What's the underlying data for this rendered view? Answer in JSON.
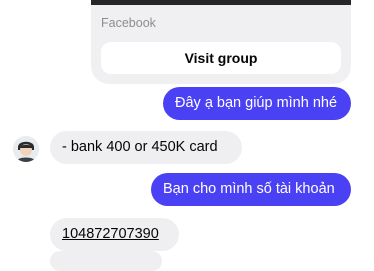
{
  "shared_card": {
    "source": "Facebook",
    "button_label": "Visit group"
  },
  "messages": [
    {
      "direction": "outgoing",
      "text": "Đây ạ bạn giúp mình nhé"
    },
    {
      "direction": "incoming",
      "text": "- bank 400 or 450K card"
    },
    {
      "direction": "outgoing",
      "text": "Bạn cho mình số tài khoản"
    },
    {
      "direction": "incoming",
      "text": "104872707390"
    }
  ],
  "colors": {
    "outgoing_bubble": "#4b41f4",
    "incoming_bubble": "#efeff1",
    "card_background": "#f0f0f2"
  }
}
